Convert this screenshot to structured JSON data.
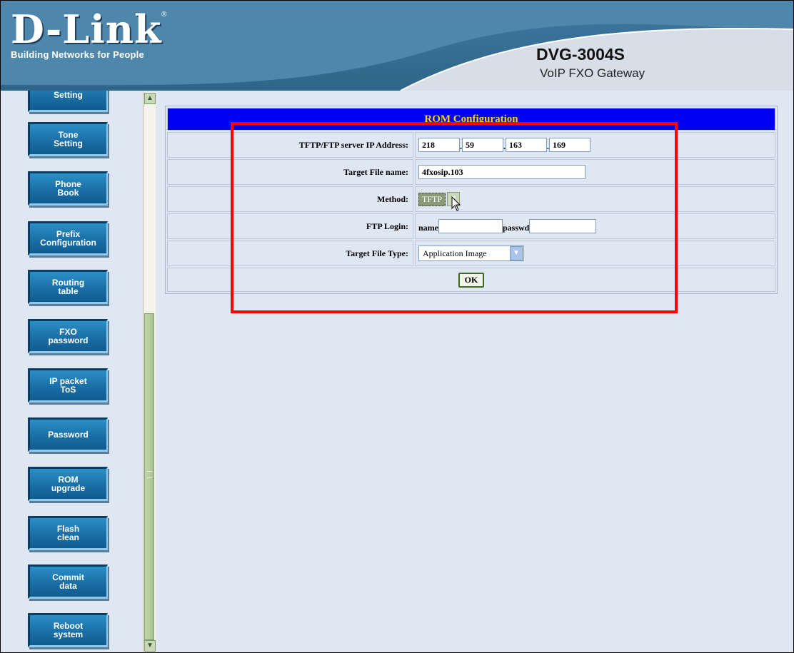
{
  "header": {
    "logo_main": "D-Link",
    "logo_sub": "Building Networks for People",
    "model": "DVG-3004S",
    "model_sub": "VoIP FXO Gateway"
  },
  "sidebar": {
    "items": [
      {
        "label": "Setting"
      },
      {
        "label": "Tone\nSetting"
      },
      {
        "label": "Phone\nBook"
      },
      {
        "label": "Prefix\nConfiguration"
      },
      {
        "label": "Routing\ntable"
      },
      {
        "label": "FXO\npassword"
      },
      {
        "label": "IP packet\nToS"
      },
      {
        "label": "Password"
      },
      {
        "label": "ROM\nupgrade"
      },
      {
        "label": "Flash\nclean"
      },
      {
        "label": "Commit\ndata"
      },
      {
        "label": "Reboot\nsystem"
      }
    ]
  },
  "rom": {
    "title": "ROM Configuration",
    "ip_label": "TFTP/FTP server IP Address:",
    "ip": [
      "218",
      "59",
      "163",
      "169"
    ],
    "fname_label": "Target File name:",
    "fname": "4fxosip.103",
    "method_label": "Method:",
    "method": "TFTP",
    "login_label": "FTP Login:",
    "name_label": "name",
    "name_value": "",
    "passwd_label": "passwd",
    "passwd_value": "",
    "ftype_label": "Target File Type:",
    "ftype": "Application Image",
    "ok": "OK"
  },
  "colors": {
    "title_bg": "#0000f5",
    "title_fg": "#ffd200",
    "highlight": "#ff0000",
    "nav_button": "#1a6fa6"
  }
}
